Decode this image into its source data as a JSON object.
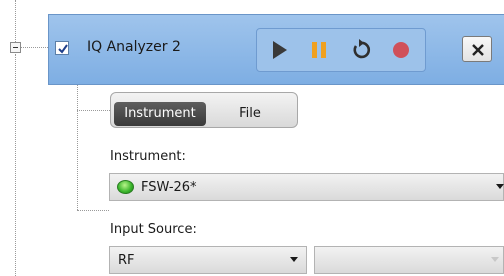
{
  "module": {
    "title": "IQ Analyzer 2",
    "enabled": true
  },
  "playbar": {
    "buttons": [
      "play",
      "pause",
      "loop",
      "record"
    ]
  },
  "source_toggle": {
    "options": [
      "Instrument",
      "File"
    ],
    "selected": "Instrument"
  },
  "instrument": {
    "label": "Instrument:",
    "value": "FSW-26*",
    "status_color": "#38b32a"
  },
  "input_source": {
    "label": "Input Source:",
    "value": "RF",
    "secondary_value": ""
  },
  "colors": {
    "header_blue": "#8fb8e8",
    "pause_orange": "#f0a020",
    "record_red": "#d0505a"
  }
}
